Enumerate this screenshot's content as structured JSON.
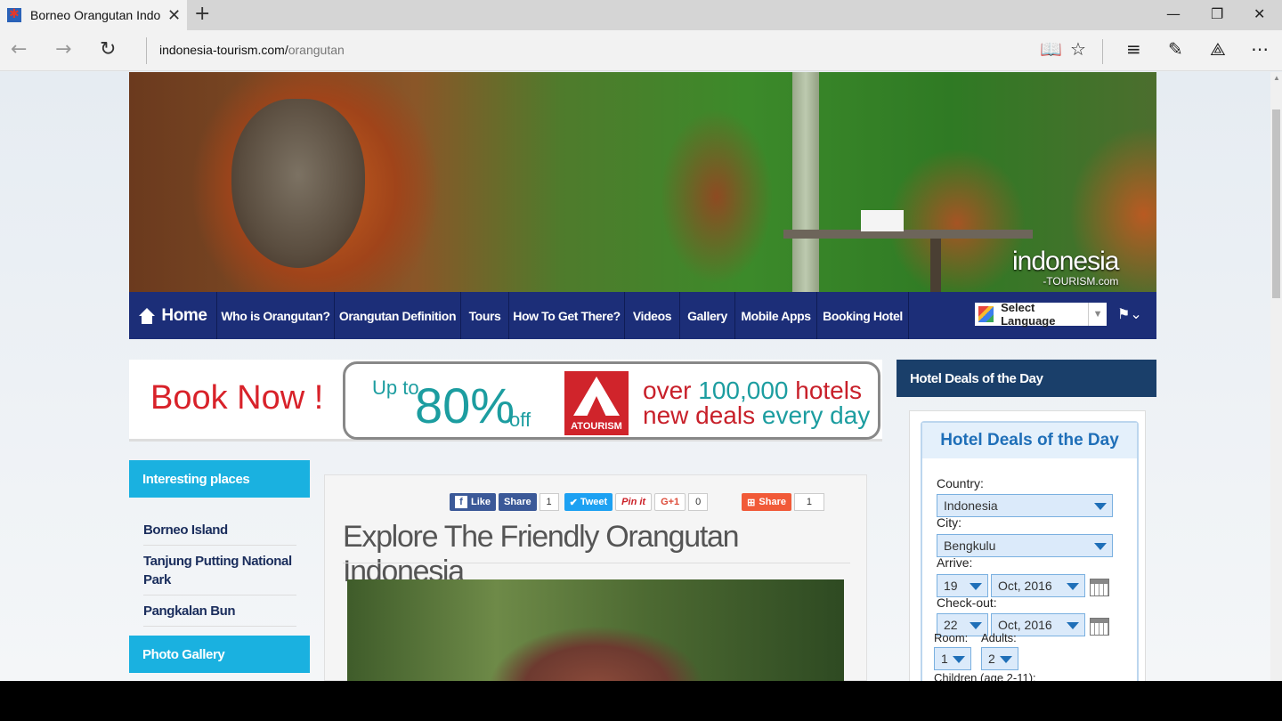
{
  "browser": {
    "tab_title": "Borneo Orangutan Indo",
    "url_host": "indonesia-tourism.com/",
    "url_path": "orangutan"
  },
  "banner": {
    "watermark_main": "indonesia",
    "watermark_sub": "-TOURISM.com"
  },
  "sitenav": {
    "home": "Home",
    "items": [
      "Who is Orangutan?",
      "Orangutan Definition",
      "Tours",
      "How To Get There?",
      "Videos",
      "Gallery",
      "Mobile Apps",
      "Booking Hotel"
    ],
    "language": "Select Language"
  },
  "promo": {
    "book_now": "Book Now !",
    "up_to": "Up to",
    "percent": "80%",
    "off": "off",
    "logo_text": "ATOURISM",
    "line1_a": "over ",
    "line1_b": "100,000 ",
    "line1_c": "hotels",
    "line2_a": "new deals ",
    "line2_b": "every day"
  },
  "sidebar": {
    "interesting_title": "Interesting places",
    "places": [
      "Borneo Island",
      "Tanjung Putting National Park",
      "Pangkalan Bun"
    ],
    "gallery_title": "Photo Gallery"
  },
  "article": {
    "share": {
      "like": "Like",
      "fb_share": "Share",
      "fb_count": "1",
      "tweet": "Tweet",
      "pinit": "Pin it",
      "gplus": "G+1",
      "gplus_count": "0",
      "share": "Share",
      "share_count": "1"
    },
    "title": "Explore The Friendly Orangutan Indonesia"
  },
  "deals": {
    "header": "Hotel Deals of the Day",
    "widget_title": "Hotel Deals of the Day",
    "country_label": "Country:",
    "country_value": "Indonesia",
    "city_label": "City:",
    "city_value": "Bengkulu",
    "arrive_label": "Arrive:",
    "arrive_day": "19",
    "arrive_month": "Oct, 2016",
    "checkout_label": "Check-out:",
    "checkout_day": "22",
    "checkout_month": "Oct, 2016",
    "room_label": "Room:",
    "room_value": "1",
    "adults_label": "Adults:",
    "adults_value": "2",
    "children_label": "Children (age 2-11):"
  },
  "colors": {
    "nav_blue": "#1c2e78",
    "sidebar_cyan": "#1ab1e0",
    "deals_navy": "#1a3f6a",
    "promo_red": "#d8222a",
    "promo_teal": "#1c9da0"
  }
}
